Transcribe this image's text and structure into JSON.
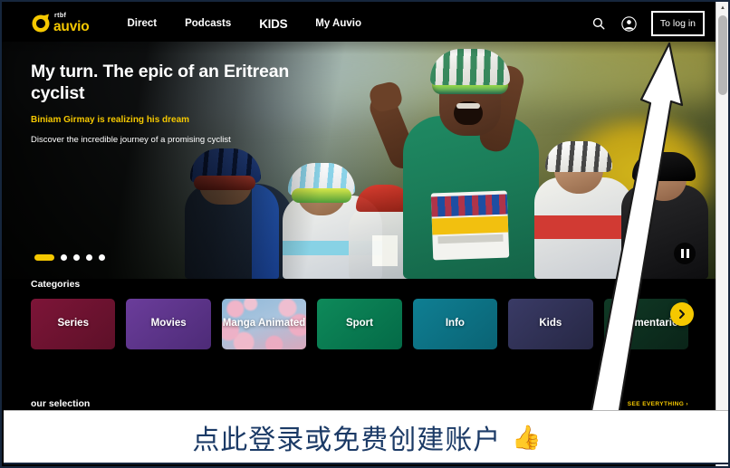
{
  "header": {
    "logo": {
      "brand_small": "rtbf",
      "brand_main": "auvio",
      "brand_color": "#f5c800"
    },
    "nav": [
      {
        "label": "Direct"
      },
      {
        "label": "Podcasts"
      },
      {
        "label": "KIDS"
      },
      {
        "label": "My Auvio"
      }
    ],
    "search_icon": "search-icon",
    "account_icon": "user-avatar-icon",
    "login_label": "To log in"
  },
  "hero": {
    "title": "My turn. The epic of an Eritrean cyclist",
    "subtitle": "Biniam Girmay is realizing his dream",
    "description": "Discover the incredible journey of a promising cyclist",
    "subtitle_color": "#f5c800",
    "carousel": {
      "total_slides": 5,
      "active_slide": 1
    },
    "pause_label": "Pause"
  },
  "categories": {
    "title": "Categories",
    "next_icon": "chevron-right-icon",
    "items": [
      {
        "label": "Series",
        "color": "#7d1538"
      },
      {
        "label": "Movies",
        "color": "#6b3d9b"
      },
      {
        "label": "Manga Animated",
        "color": "#a8c4de"
      },
      {
        "label": "Sport",
        "color": "#0e8a5a"
      },
      {
        "label": "Info",
        "color": "#0f7f93"
      },
      {
        "label": "Kids",
        "color": "#3a3b66"
      },
      {
        "label": "Documentaries",
        "color": "#103a26"
      }
    ]
  },
  "selection": {
    "title": "our selection",
    "see_all_label": "SEE EVERYTHING ›",
    "see_all_color": "#f5c800"
  },
  "scrollbar": {
    "up_arrow": "▲",
    "down_arrow": "▼"
  },
  "annotation": {
    "arrow": "up-right-pointing-arrow",
    "caption_text": "点此登录或免费创建账户",
    "caption_emoji": "👍",
    "caption_color": "#1b3a66"
  }
}
